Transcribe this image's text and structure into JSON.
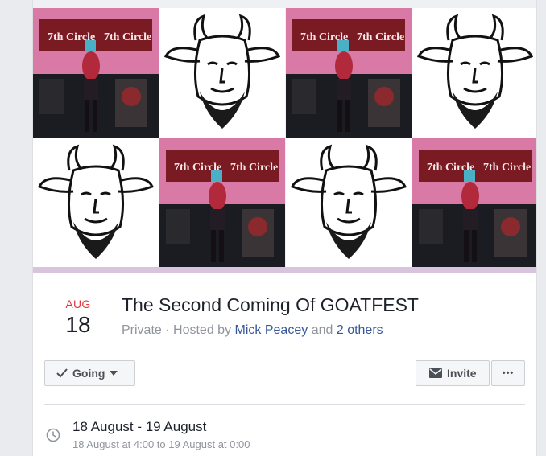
{
  "event": {
    "month": "AUG",
    "day": "18",
    "title": "The Second Coming Of GOATFEST",
    "privacy": "Private",
    "separator": "·",
    "hosted_by_prefix": "Hosted by",
    "host": "Mick Peacey",
    "and_text": "and",
    "others": "2 others"
  },
  "cover": {
    "band_banner_text": "7th Circle",
    "tile_order": [
      "band-photo",
      "goat-drawing",
      "band-photo",
      "goat-drawing",
      "goat-drawing",
      "band-photo",
      "goat-drawing",
      "band-photo"
    ]
  },
  "actions": {
    "going_label": "Going",
    "invite_label": "Invite",
    "more_label": "•••"
  },
  "when": {
    "range": "18 August - 19 August",
    "detail": "18 August at 4:00 to 19 August at 0:00"
  },
  "icons": {
    "going": "check-icon",
    "going_caret": "caret-down-icon",
    "invite": "envelope-icon",
    "more": "more-dots-icon",
    "when": "clock-icon"
  },
  "colors": {
    "month_accent": "#e0393e",
    "link": "#365899",
    "muted": "#90949c"
  }
}
